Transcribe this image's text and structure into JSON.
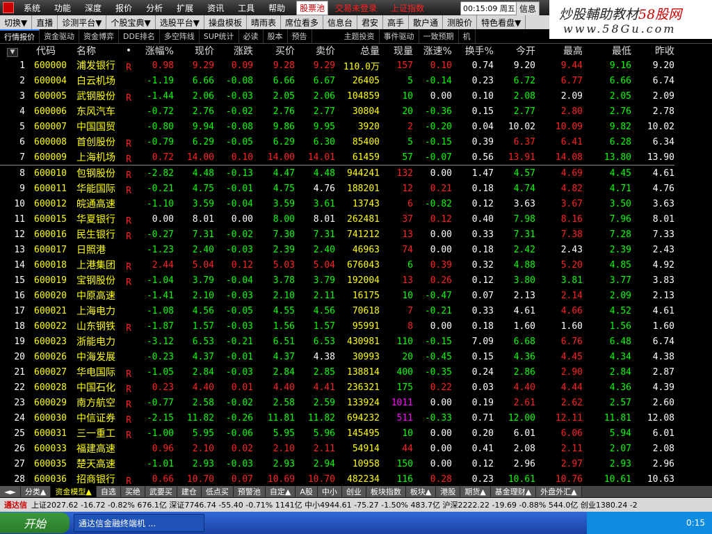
{
  "menu": [
    "系统",
    "功能",
    "深度",
    "报价",
    "分析",
    "扩展",
    "资讯",
    "工具",
    "帮助"
  ],
  "gupiaochi": "股票池",
  "red_links": [
    "交易未登录",
    "上证指数"
  ],
  "clock": "00:15:09",
  "weekday": "周五",
  "xinxi": "信息",
  "watermark": {
    "line1_a": "炒股輔助教材",
    "line1_b": "58股网",
    "line2": "www.58Gu.com"
  },
  "toolbar": [
    "切换▼",
    "直播",
    "诊测平台▼",
    "个股宝典▼",
    "选股平台▼",
    "操盘模板",
    "晴雨表",
    "席位看多",
    "信息台",
    "君安",
    "高手",
    "散户通",
    "测股价",
    "特色看盘▼"
  ],
  "tabs": [
    "行情报价",
    "资金驱动",
    "资金博弈",
    "DDE排名",
    "多空阵线",
    "SUP统计",
    "必读",
    "股本",
    "预告",
    "主题投资",
    "事件驱动",
    "一致预期",
    "机"
  ],
  "columns": [
    "代码",
    "名称",
    "•",
    "涨幅%",
    "现价",
    "涨跌",
    "买价",
    "卖价",
    "总量",
    "现量",
    "涨速%",
    "换手%",
    "今开",
    "最高",
    "最低",
    "昨收"
  ],
  "rows": [
    {
      "i": "1",
      "code": "600000",
      "name": "浦发银行",
      "r": "R",
      "pct": "0.98",
      "pct_c": "r",
      "price": "9.29",
      "price_c": "r",
      "chg": "0.09",
      "chg_c": "r",
      "bid": "9.28",
      "bid_c": "r",
      "ask": "9.29",
      "ask_c": "r",
      "vol": "110.0万",
      "cur": "157",
      "cur_c": "r",
      "spd": "0.10",
      "spd_c": "r",
      "turn": "0.74",
      "open": "9.20",
      "open_c": "w",
      "high": "9.44",
      "high_c": "r",
      "low": "9.16",
      "low_c": "g",
      "prev": "9.20"
    },
    {
      "i": "2",
      "code": "600004",
      "name": "白云机场",
      "r": "",
      "pct": "-1.19",
      "pct_c": "g",
      "price": "6.66",
      "price_c": "g",
      "chg": "-0.08",
      "chg_c": "g",
      "bid": "6.66",
      "bid_c": "g",
      "ask": "6.67",
      "ask_c": "g",
      "vol": "26405",
      "cur": "5",
      "cur_c": "g",
      "spd": "-0.14",
      "spd_c": "g",
      "turn": "0.23",
      "open": "6.72",
      "open_c": "g",
      "high": "6.77",
      "high_c": "r",
      "low": "6.66",
      "low_c": "g",
      "prev": "6.74"
    },
    {
      "i": "3",
      "code": "600005",
      "name": "武钢股份",
      "r": "R",
      "pct": "-1.44",
      "pct_c": "g",
      "price": "2.06",
      "price_c": "g",
      "chg": "-0.03",
      "chg_c": "g",
      "bid": "2.05",
      "bid_c": "g",
      "ask": "2.06",
      "ask_c": "g",
      "vol": "104859",
      "cur": "10",
      "cur_c": "g",
      "spd": "0.00",
      "spd_c": "w",
      "turn": "0.10",
      "open": "2.08",
      "open_c": "g",
      "high": "2.09",
      "high_c": "w",
      "low": "2.05",
      "low_c": "g",
      "prev": "2.09"
    },
    {
      "i": "4",
      "code": "600006",
      "name": "东风汽车",
      "r": "",
      "pct": "-0.72",
      "pct_c": "g",
      "price": "2.76",
      "price_c": "g",
      "chg": "-0.02",
      "chg_c": "g",
      "bid": "2.76",
      "bid_c": "g",
      "ask": "2.77",
      "ask_c": "g",
      "vol": "30804",
      "cur": "20",
      "cur_c": "g",
      "spd": "-0.36",
      "spd_c": "g",
      "turn": "0.15",
      "open": "2.77",
      "open_c": "g",
      "high": "2.80",
      "high_c": "r",
      "low": "2.76",
      "low_c": "g",
      "prev": "2.78"
    },
    {
      "i": "5",
      "code": "600007",
      "name": "中国国贸",
      "r": "",
      "pct": "-0.80",
      "pct_c": "g",
      "price": "9.94",
      "price_c": "g",
      "chg": "-0.08",
      "chg_c": "g",
      "bid": "9.86",
      "bid_c": "g",
      "ask": "9.95",
      "ask_c": "g",
      "vol": "3920",
      "cur": "2",
      "cur_c": "r",
      "spd": "-0.20",
      "spd_c": "g",
      "turn": "0.04",
      "open": "10.02",
      "open_c": "w",
      "high": "10.09",
      "high_c": "r",
      "low": "9.82",
      "low_c": "g",
      "prev": "10.02"
    },
    {
      "i": "6",
      "code": "600008",
      "name": "首创股份",
      "r": "R",
      "pct": "-0.79",
      "pct_c": "g",
      "price": "6.29",
      "price_c": "g",
      "chg": "-0.05",
      "chg_c": "g",
      "bid": "6.29",
      "bid_c": "g",
      "ask": "6.30",
      "ask_c": "g",
      "vol": "85400",
      "cur": "5",
      "cur_c": "g",
      "spd": "-0.15",
      "spd_c": "g",
      "turn": "0.39",
      "open": "6.37",
      "open_c": "r",
      "high": "6.41",
      "high_c": "r",
      "low": "6.28",
      "low_c": "g",
      "prev": "6.34"
    },
    {
      "i": "7",
      "code": "600009",
      "name": "上海机场",
      "r": "R",
      "pct": "0.72",
      "pct_c": "r",
      "price": "14.00",
      "price_c": "r",
      "chg": "0.10",
      "chg_c": "r",
      "bid": "14.00",
      "bid_c": "r",
      "ask": "14.01",
      "ask_c": "r",
      "vol": "61459",
      "cur": "57",
      "cur_c": "g",
      "spd": "-0.07",
      "spd_c": "g",
      "turn": "0.56",
      "open": "13.91",
      "open_c": "r",
      "high": "14.08",
      "high_c": "r",
      "low": "13.80",
      "low_c": "g",
      "prev": "13.90"
    },
    {
      "i": "8",
      "code": "600010",
      "name": "包钢股份",
      "r": "R",
      "pct": "-2.82",
      "pct_c": "g",
      "price": "4.48",
      "price_c": "g",
      "chg": "-0.13",
      "chg_c": "g",
      "bid": "4.47",
      "bid_c": "g",
      "ask": "4.48",
      "ask_c": "g",
      "vol": "944241",
      "cur": "132",
      "cur_c": "r",
      "spd": "0.00",
      "spd_c": "w",
      "turn": "1.47",
      "open": "4.57",
      "open_c": "g",
      "high": "4.69",
      "high_c": "r",
      "low": "4.45",
      "low_c": "g",
      "prev": "4.61"
    },
    {
      "i": "9",
      "code": "600011",
      "name": "华能国际",
      "r": "R",
      "pct": "-0.21",
      "pct_c": "g",
      "price": "4.75",
      "price_c": "g",
      "chg": "-0.01",
      "chg_c": "g",
      "bid": "4.75",
      "bid_c": "g",
      "ask": "4.76",
      "ask_c": "w",
      "vol": "188201",
      "cur": "12",
      "cur_c": "r",
      "spd": "0.21",
      "spd_c": "r",
      "turn": "0.18",
      "open": "4.74",
      "open_c": "g",
      "high": "4.82",
      "high_c": "r",
      "low": "4.71",
      "low_c": "g",
      "prev": "4.76"
    },
    {
      "i": "10",
      "code": "600012",
      "name": "皖通高速",
      "r": "",
      "pct": "-1.10",
      "pct_c": "g",
      "price": "3.59",
      "price_c": "g",
      "chg": "-0.04",
      "chg_c": "g",
      "bid": "3.59",
      "bid_c": "g",
      "ask": "3.61",
      "ask_c": "g",
      "vol": "13743",
      "cur": "6",
      "cur_c": "r",
      "spd": "-0.82",
      "spd_c": "g",
      "turn": "0.12",
      "open": "3.63",
      "open_c": "w",
      "high": "3.67",
      "high_c": "r",
      "low": "3.50",
      "low_c": "g",
      "prev": "3.63"
    },
    {
      "i": "11",
      "code": "600015",
      "name": "华夏银行",
      "r": "R",
      "pct": "0.00",
      "pct_c": "w",
      "price": "8.01",
      "price_c": "w",
      "chg": "0.00",
      "chg_c": "w",
      "bid": "8.00",
      "bid_c": "g",
      "ask": "8.01",
      "ask_c": "w",
      "vol": "262481",
      "cur": "37",
      "cur_c": "r",
      "spd": "0.12",
      "spd_c": "r",
      "turn": "0.40",
      "open": "7.98",
      "open_c": "g",
      "high": "8.16",
      "high_c": "r",
      "low": "7.96",
      "low_c": "g",
      "prev": "8.01"
    },
    {
      "i": "12",
      "code": "600016",
      "name": "民生银行",
      "r": "R",
      "pct": "-0.27",
      "pct_c": "g",
      "price": "7.31",
      "price_c": "g",
      "chg": "-0.02",
      "chg_c": "g",
      "bid": "7.30",
      "bid_c": "g",
      "ask": "7.31",
      "ask_c": "g",
      "vol": "741212",
      "cur": "13",
      "cur_c": "r",
      "spd": "0.00",
      "spd_c": "w",
      "turn": "0.33",
      "open": "7.31",
      "open_c": "g",
      "high": "7.38",
      "high_c": "r",
      "low": "7.28",
      "low_c": "g",
      "prev": "7.33"
    },
    {
      "i": "13",
      "code": "600017",
      "name": "日照港",
      "r": "",
      "pct": "-1.23",
      "pct_c": "g",
      "price": "2.40",
      "price_c": "g",
      "chg": "-0.03",
      "chg_c": "g",
      "bid": "2.39",
      "bid_c": "g",
      "ask": "2.40",
      "ask_c": "g",
      "vol": "46963",
      "cur": "74",
      "cur_c": "r",
      "spd": "0.00",
      "spd_c": "w",
      "turn": "0.18",
      "open": "2.42",
      "open_c": "g",
      "high": "2.43",
      "high_c": "w",
      "low": "2.39",
      "low_c": "g",
      "prev": "2.43"
    },
    {
      "i": "14",
      "code": "600018",
      "name": "上港集团",
      "r": "R",
      "pct": "2.44",
      "pct_c": "r",
      "price": "5.04",
      "price_c": "r",
      "chg": "0.12",
      "chg_c": "r",
      "bid": "5.03",
      "bid_c": "r",
      "ask": "5.04",
      "ask_c": "r",
      "vol": "676043",
      "cur": "6",
      "cur_c": "g",
      "spd": "0.39",
      "spd_c": "r",
      "turn": "0.32",
      "open": "4.88",
      "open_c": "g",
      "high": "5.20",
      "high_c": "r",
      "low": "4.85",
      "low_c": "g",
      "prev": "4.92"
    },
    {
      "i": "15",
      "code": "600019",
      "name": "宝钢股份",
      "r": "R",
      "pct": "-1.04",
      "pct_c": "g",
      "price": "3.79",
      "price_c": "g",
      "chg": "-0.04",
      "chg_c": "g",
      "bid": "3.78",
      "bid_c": "g",
      "ask": "3.79",
      "ask_c": "g",
      "vol": "192004",
      "cur": "13",
      "cur_c": "r",
      "spd": "0.26",
      "spd_c": "r",
      "turn": "0.12",
      "open": "3.80",
      "open_c": "g",
      "high": "3.81",
      "high_c": "g",
      "low": "3.77",
      "low_c": "g",
      "prev": "3.83"
    },
    {
      "i": "16",
      "code": "600020",
      "name": "中原高速",
      "r": "",
      "pct": "-1.41",
      "pct_c": "g",
      "price": "2.10",
      "price_c": "g",
      "chg": "-0.03",
      "chg_c": "g",
      "bid": "2.10",
      "bid_c": "g",
      "ask": "2.11",
      "ask_c": "g",
      "vol": "16175",
      "cur": "10",
      "cur_c": "g",
      "spd": "-0.47",
      "spd_c": "g",
      "turn": "0.07",
      "open": "2.13",
      "open_c": "w",
      "high": "2.14",
      "high_c": "r",
      "low": "2.09",
      "low_c": "g",
      "prev": "2.13"
    },
    {
      "i": "17",
      "code": "600021",
      "name": "上海电力",
      "r": "",
      "pct": "-1.08",
      "pct_c": "g",
      "price": "4.56",
      "price_c": "g",
      "chg": "-0.05",
      "chg_c": "g",
      "bid": "4.55",
      "bid_c": "g",
      "ask": "4.56",
      "ask_c": "g",
      "vol": "70618",
      "cur": "7",
      "cur_c": "r",
      "spd": "-0.21",
      "spd_c": "g",
      "turn": "0.33",
      "open": "4.61",
      "open_c": "w",
      "high": "4.66",
      "high_c": "r",
      "low": "4.52",
      "low_c": "g",
      "prev": "4.61"
    },
    {
      "i": "18",
      "code": "600022",
      "name": "山东钢铁",
      "r": "R",
      "pct": "-1.87",
      "pct_c": "g",
      "price": "1.57",
      "price_c": "g",
      "chg": "-0.03",
      "chg_c": "g",
      "bid": "1.56",
      "bid_c": "g",
      "ask": "1.57",
      "ask_c": "g",
      "vol": "95991",
      "cur": "8",
      "cur_c": "r",
      "spd": "0.00",
      "spd_c": "w",
      "turn": "0.18",
      "open": "1.60",
      "open_c": "w",
      "high": "1.60",
      "high_c": "w",
      "low": "1.56",
      "low_c": "g",
      "prev": "1.60"
    },
    {
      "i": "19",
      "code": "600023",
      "name": "浙能电力",
      "r": "",
      "pct": "-3.12",
      "pct_c": "g",
      "price": "6.53",
      "price_c": "g",
      "chg": "-0.21",
      "chg_c": "g",
      "bid": "6.51",
      "bid_c": "g",
      "ask": "6.53",
      "ask_c": "g",
      "vol": "430981",
      "cur": "110",
      "cur_c": "g",
      "spd": "-0.15",
      "spd_c": "g",
      "turn": "7.09",
      "open": "6.68",
      "open_c": "g",
      "high": "6.76",
      "high_c": "r",
      "low": "6.48",
      "low_c": "g",
      "prev": "6.74"
    },
    {
      "i": "20",
      "code": "600026",
      "name": "中海发展",
      "r": "",
      "pct": "-0.23",
      "pct_c": "g",
      "price": "4.37",
      "price_c": "g",
      "chg": "-0.01",
      "chg_c": "g",
      "bid": "4.37",
      "bid_c": "g",
      "ask": "4.38",
      "ask_c": "w",
      "vol": "30993",
      "cur": "20",
      "cur_c": "g",
      "spd": "-0.45",
      "spd_c": "g",
      "turn": "0.15",
      "open": "4.36",
      "open_c": "g",
      "high": "4.45",
      "high_c": "r",
      "low": "4.34",
      "low_c": "g",
      "prev": "4.38"
    },
    {
      "i": "21",
      "code": "600027",
      "name": "华电国际",
      "r": "R",
      "pct": "-1.05",
      "pct_c": "g",
      "price": "2.84",
      "price_c": "g",
      "chg": "-0.03",
      "chg_c": "g",
      "bid": "2.84",
      "bid_c": "g",
      "ask": "2.85",
      "ask_c": "g",
      "vol": "138814",
      "cur": "400",
      "cur_c": "g",
      "spd": "-0.35",
      "spd_c": "g",
      "turn": "0.24",
      "open": "2.86",
      "open_c": "g",
      "high": "2.90",
      "high_c": "r",
      "low": "2.84",
      "low_c": "g",
      "prev": "2.87"
    },
    {
      "i": "22",
      "code": "600028",
      "name": "中国石化",
      "r": "R",
      "pct": "0.23",
      "pct_c": "r",
      "price": "4.40",
      "price_c": "r",
      "chg": "0.01",
      "chg_c": "r",
      "bid": "4.40",
      "bid_c": "r",
      "ask": "4.41",
      "ask_c": "r",
      "vol": "236321",
      "cur": "175",
      "cur_c": "g",
      "spd": "0.22",
      "spd_c": "r",
      "turn": "0.03",
      "open": "4.40",
      "open_c": "r",
      "high": "4.44",
      "high_c": "r",
      "low": "4.36",
      "low_c": "g",
      "prev": "4.39"
    },
    {
      "i": "23",
      "code": "600029",
      "name": "南方航空",
      "r": "R",
      "pct": "-0.77",
      "pct_c": "g",
      "price": "2.58",
      "price_c": "g",
      "chg": "-0.02",
      "chg_c": "g",
      "bid": "2.58",
      "bid_c": "g",
      "ask": "2.59",
      "ask_c": "g",
      "vol": "133924",
      "cur": "1011",
      "cur_c": "m",
      "spd": "0.00",
      "spd_c": "w",
      "turn": "0.19",
      "open": "2.61",
      "open_c": "r",
      "high": "2.62",
      "high_c": "r",
      "low": "2.57",
      "low_c": "g",
      "prev": "2.60"
    },
    {
      "i": "24",
      "code": "600030",
      "name": "中信证券",
      "r": "R",
      "pct": "-2.15",
      "pct_c": "g",
      "price": "11.82",
      "price_c": "g",
      "chg": "-0.26",
      "chg_c": "g",
      "bid": "11.81",
      "bid_c": "g",
      "ask": "11.82",
      "ask_c": "g",
      "vol": "694232",
      "cur": "511",
      "cur_c": "m",
      "spd": "-0.33",
      "spd_c": "g",
      "turn": "0.71",
      "open": "12.00",
      "open_c": "g",
      "high": "12.11",
      "high_c": "r",
      "low": "11.81",
      "low_c": "g",
      "prev": "12.08"
    },
    {
      "i": "25",
      "code": "600031",
      "name": "三一重工",
      "r": "R",
      "pct": "-1.00",
      "pct_c": "g",
      "price": "5.95",
      "price_c": "g",
      "chg": "-0.06",
      "chg_c": "g",
      "bid": "5.95",
      "bid_c": "g",
      "ask": "5.96",
      "ask_c": "g",
      "vol": "145495",
      "cur": "10",
      "cur_c": "g",
      "spd": "0.00",
      "spd_c": "w",
      "turn": "0.20",
      "open": "6.01",
      "open_c": "w",
      "high": "6.06",
      "high_c": "r",
      "low": "5.94",
      "low_c": "g",
      "prev": "6.01"
    },
    {
      "i": "26",
      "code": "600033",
      "name": "福建高速",
      "r": "",
      "pct": "0.96",
      "pct_c": "r",
      "price": "2.10",
      "price_c": "r",
      "chg": "0.02",
      "chg_c": "r",
      "bid": "2.10",
      "bid_c": "r",
      "ask": "2.11",
      "ask_c": "r",
      "vol": "54914",
      "cur": "44",
      "cur_c": "r",
      "spd": "0.00",
      "spd_c": "w",
      "turn": "0.41",
      "open": "2.08",
      "open_c": "w",
      "high": "2.11",
      "high_c": "r",
      "low": "2.07",
      "low_c": "g",
      "prev": "2.08"
    },
    {
      "i": "27",
      "code": "600035",
      "name": "楚天高速",
      "r": "",
      "pct": "-1.01",
      "pct_c": "g",
      "price": "2.93",
      "price_c": "g",
      "chg": "-0.03",
      "chg_c": "g",
      "bid": "2.93",
      "bid_c": "g",
      "ask": "2.94",
      "ask_c": "g",
      "vol": "10958",
      "cur": "150",
      "cur_c": "g",
      "spd": "0.00",
      "spd_c": "w",
      "turn": "0.12",
      "open": "2.96",
      "open_c": "w",
      "high": "2.97",
      "high_c": "r",
      "low": "2.93",
      "low_c": "g",
      "prev": "2.96"
    },
    {
      "i": "28",
      "code": "600036",
      "name": "招商银行",
      "r": "R",
      "pct": "0.66",
      "pct_c": "r",
      "price": "10.70",
      "price_c": "r",
      "chg": "0.07",
      "chg_c": "r",
      "bid": "10.69",
      "bid_c": "r",
      "ask": "10.70",
      "ask_c": "r",
      "vol": "482234",
      "cur": "116",
      "cur_c": "g",
      "spd": "0.28",
      "spd_c": "r",
      "turn": "0.23",
      "open": "10.61",
      "open_c": "g",
      "high": "10.76",
      "high_c": "r",
      "low": "10.61",
      "low_c": "g",
      "prev": "10.63"
    }
  ],
  "bottom_tabs": [
    "分类▲",
    "资金模型▲",
    "自选",
    "买绝",
    "武要买",
    "建仓",
    "低点买",
    "预警池",
    "自定▲",
    "A股",
    "中小",
    "创业",
    "板块指数",
    "板块▲",
    "港股",
    "期货▲",
    "基金理财▲",
    "外盘外汇▲"
  ],
  "ticker": {
    "logo": "通达信",
    "text": "上证2027.62  -16.72  -0.82%  676.1亿  深证7746.74  -55.40  -0.71%  1141亿  中小4944.61  -75.27  -1.50%  483.7亿  沪深2222.22  -19.69  -0.88%  544.0亿  创业1380.24  -2"
  },
  "taskbar": {
    "start": "开始",
    "app": "通达信金融终端机 ...",
    "time": "0:15"
  }
}
